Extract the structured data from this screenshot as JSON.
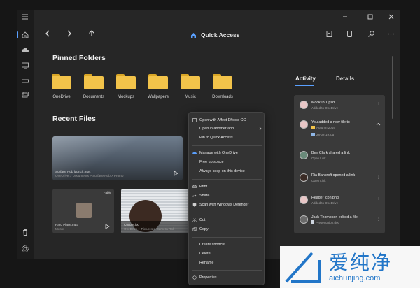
{
  "header": {
    "title": "Quick Access"
  },
  "sections": {
    "pinned": "Pinned Folders",
    "recent": "Recent Files"
  },
  "folders": [
    "OneDrive",
    "Documents",
    "Mockups",
    "Wallpapers",
    "Music",
    "Downloads"
  ],
  "recent_files": [
    {
      "name": "Surface Hub launch.mp4",
      "path": "OneDrive > Documents > Surface Hub > Promo"
    },
    {
      "name": "Hard Place.mp3",
      "path": "Music",
      "badge": "Fable"
    },
    {
      "name": "Couple.jpg",
      "path": "OneDrive > Pictures > Camera Roll"
    }
  ],
  "panel": {
    "tabs": [
      "Activity",
      "Details"
    ],
    "items": [
      {
        "title": "Mockup 1.psd",
        "sub": "Added to OneDrive"
      },
      {
        "title": "You added a new file to",
        "sub": "Autumn 2019",
        "extra": "28-02-19.jpg"
      },
      {
        "title": "Ben Clark shared a link",
        "sub": "Open Link"
      },
      {
        "title": "Ria Bancroft opened a link",
        "sub": "Open Link"
      },
      {
        "title": "Header icon.png",
        "sub": "Added to OneDrive"
      },
      {
        "title": "Jack Thompson edited a file",
        "sub": "Presentation.doc"
      }
    ]
  },
  "context_menu": {
    "items": [
      "Open with Affect Effects CC",
      "Open in another app...",
      "Pin to Quick Access",
      "Manage with OneDrive",
      "Free up space",
      "Always keep on this device",
      "Print",
      "Share",
      "Scan with Windows Defender",
      "Cut",
      "Copy",
      "Create shortcut",
      "Delete",
      "Rename",
      "Properties"
    ]
  },
  "watermark": {
    "cn": "爱纯净",
    "url": "aichunjing.com"
  },
  "colors": {
    "accent": "#5aa0ff",
    "folder": "#f2c34a",
    "watermark": "#2276c8"
  }
}
